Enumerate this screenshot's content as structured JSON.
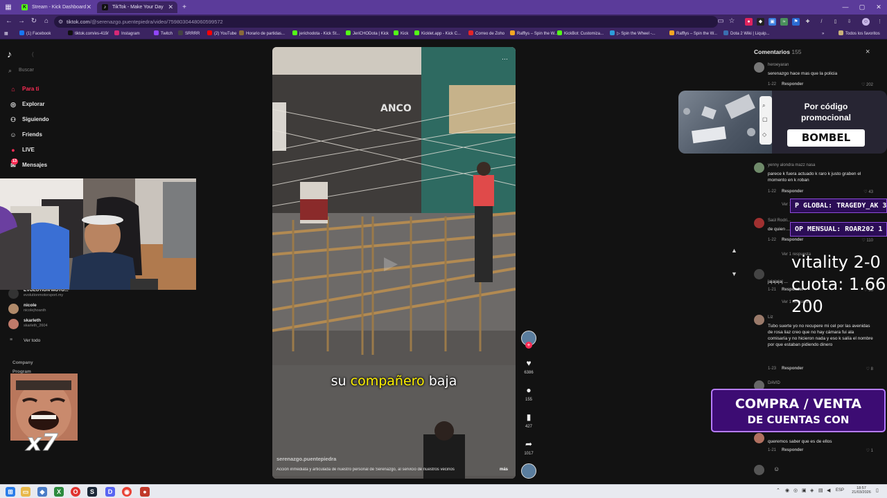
{
  "browser": {
    "tabs": [
      {
        "title": "Stream - Kick Dashboard",
        "favicon": "kick-favicon",
        "active": false
      },
      {
        "title": "TikTok - Make Your Day",
        "favicon": "tiktok-favicon",
        "active": true
      }
    ],
    "new_tab_label": "+",
    "url_host": "tiktok.com",
    "url_path": "/@serenazgo.puentepiedra/video/7598030448060599572",
    "bookmarks": [
      {
        "label": "(1) Facebook",
        "color": "#1877f2"
      },
      {
        "label": "tiktok.com/es-419/",
        "color": "#111111"
      },
      {
        "label": "Instagram",
        "color": "#d62976"
      },
      {
        "label": "Twitch",
        "color": "#9146ff"
      },
      {
        "label": "SRRRR",
        "color": "#444444"
      },
      {
        "label": "(2) YouTube",
        "color": "#ff0000"
      },
      {
        "label": "Horario de partidas...",
        "color": "#8a6a3a"
      },
      {
        "label": "jerichodota - Kick St...",
        "color": "#53fc18"
      },
      {
        "label": "JeriCHODota | Kick",
        "color": "#53fc18"
      },
      {
        "label": "Kick",
        "color": "#53fc18"
      },
      {
        "label": "Kicklet.app - Kick C...",
        "color": "#53fc18"
      },
      {
        "label": "Correo de Zoho",
        "color": "#e42527"
      },
      {
        "label": "Rafflys – Spin the W...",
        "color": "#f5a623"
      },
      {
        "label": "KickBot: Customiza...",
        "color": "#53fc18"
      },
      {
        "label": "▷ Spin the Wheel -...",
        "color": "#2d9cdb"
      },
      {
        "label": "Rafflys – Spin the W...",
        "color": "#f5a623"
      },
      {
        "label": "Dota 2 Wiki | Liquip...",
        "color": "#3a6fb0"
      }
    ],
    "bookmarks_more": "»",
    "all_bookmarks": "Todos los favoritos"
  },
  "sidebar": {
    "search_placeholder": "Buscar",
    "nav": [
      {
        "label": "Para ti",
        "icon": "home-icon",
        "glyph": "⌂",
        "active": true
      },
      {
        "label": "Explorar",
        "icon": "compass-icon",
        "glyph": "◎",
        "active": false
      },
      {
        "label": "Siguiendo",
        "icon": "following-icon",
        "glyph": "⚇",
        "active": false
      },
      {
        "label": "Friends",
        "icon": "friends-icon",
        "glyph": "☺",
        "active": false
      },
      {
        "label": "LIVE",
        "icon": "live-icon",
        "glyph": "●",
        "active": false
      },
      {
        "label": "Mensajes",
        "icon": "messages-icon",
        "glyph": "✉",
        "active": false
      }
    ],
    "messages_badge": "13",
    "following": [
      {
        "name": "EVOLUTION MOTO...",
        "handle": "evolutionmotorsport.my",
        "color": "#333333"
      },
      {
        "name": "nicole",
        "handle": "nicolejhoanth",
        "color": "#b08a6a"
      },
      {
        "name": "skarleth",
        "handle": "skarleth_2604",
        "color": "#c07a6a"
      }
    ],
    "see_all": "Ver todo",
    "footer": [
      "Company",
      "Program"
    ]
  },
  "video": {
    "caption": "su compañero baja",
    "caption_highlight": "compañero",
    "author": "serenazgo.puentepiedra",
    "description": "Acción inmediata y articulada de nuestro personal de Serenazgo, al servicio de nuestros vecinos",
    "more": "más",
    "bus_text": "ANCO"
  },
  "actions": {
    "likes": "6386",
    "comments": "155",
    "saves": "427",
    "shares": "1017"
  },
  "comments_panel": {
    "title": "Comentarios",
    "count": "155",
    "close": "×",
    "reply_label": "Responder",
    "items": [
      {
        "user": "heroeyaran",
        "text": "serenazgo hace mas que la policia",
        "date": "1-22",
        "likes": "202"
      },
      {
        "user": "yenny alondra mazz nasa",
        "text": "parece k fuera actuado k raro k justo graben el momento en k roban",
        "date": "1-22",
        "likes": "43"
      },
      {
        "user": "Saúl Rodri...",
        "text": "de quien ...",
        "date": "1-22",
        "likes": "110"
      },
      {
        "user": "",
        "text": "jajajajaj ...",
        "date": "1-21",
        "likes": "36"
      },
      {
        "user": "Liz",
        "text": "Tubo suerte yo no recupere mi cel por las avenidas de rosa liaz creo que no hay cámara fui ala comisaría y no hicieron nada y eso k salía el nombre por que estaban pidiendo dinero",
        "date": "1-23",
        "likes": "8"
      },
      {
        "user": "DAVID",
        "text": "",
        "date": "",
        "likes": ""
      },
      {
        "user": "",
        "text": "queremos saber que es de ellos",
        "date": "1-21",
        "likes": "1"
      }
    ],
    "view_replies": [
      "Ver 1 respuesta",
      "Ver 1 respuesta",
      "Ver 1 respuesta",
      "Ver 1 respuesta"
    ]
  },
  "overlays": {
    "promo_line1": "Por código",
    "promo_line2": "promocional",
    "promo_code": "BOMBEL",
    "pill_global": "P GLOBAL: TRAGEDY_AK 3",
    "pill_mensual": "OP MENSUAL: ROAR202 1",
    "bet_line1": "vitality 2-0",
    "bet_line2": "cuota: 1.66",
    "bet_line3": "200",
    "banner_line1": "COMPRA / VENTA",
    "banner_line2": "DE CUENTAS CON",
    "emote_multiplier": "x7"
  },
  "taskbar": {
    "lang": "ESP",
    "time": "18:57",
    "date": "21/03/2026"
  }
}
